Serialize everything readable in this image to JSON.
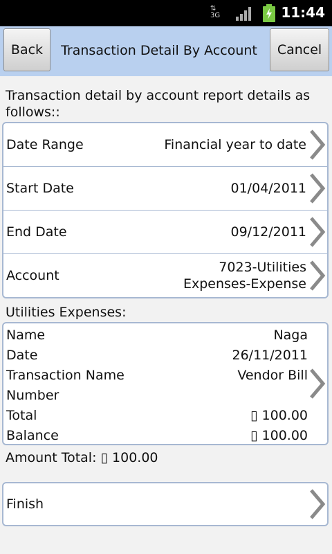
{
  "status_bar": {
    "network": "3G",
    "time": "11:44"
  },
  "header": {
    "back_label": "Back",
    "title": "Transaction Detail By Account",
    "cancel_label": "Cancel"
  },
  "intro_text": "Transaction detail by account report details as follows::",
  "parameters": [
    {
      "label": "Date Range",
      "value": "Financial year to date"
    },
    {
      "label": "Start Date",
      "value": "01/04/2011"
    },
    {
      "label": "End Date",
      "value": "09/12/2011"
    },
    {
      "label": "Account",
      "value_line1": "7023-Utilities",
      "value_line2": "Expenses-Expense"
    }
  ],
  "section_label": "Utilities Expenses:",
  "transaction": {
    "name_label": "Name",
    "name_value": "Naga",
    "date_label": "Date",
    "date_value": "26/11/2011",
    "tname_label": "Transaction Name",
    "tname_value": "Vendor Bill",
    "number_label": "Number",
    "number_value": "",
    "total_label": "Total",
    "total_value": "▯ 100.00",
    "balance_label": "Balance",
    "balance_value": "▯ 100.00"
  },
  "amount_total": "Amount Total: ▯ 100.00",
  "finish_label": "Finish",
  "colors": {
    "title_bar": "#b9d0ef",
    "panel_border": "#a7b8d2",
    "background": "#f2f2f2"
  }
}
